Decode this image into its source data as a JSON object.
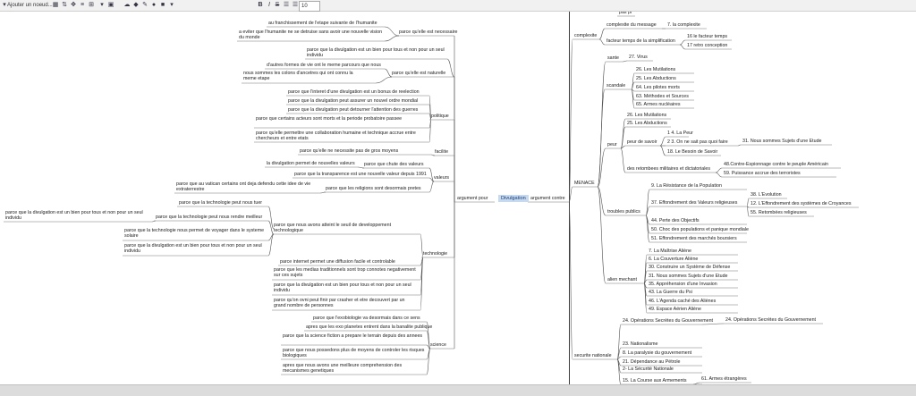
{
  "toolbar": {
    "add_node_label": "Ajouter un noeud...",
    "bold": "B",
    "italic": "I",
    "strike": "S",
    "font_size": "10"
  },
  "map": {
    "root": "Divulgation",
    "left_branch": "argument pour",
    "right_branch": "argument contre",
    "left": [
      {
        "label": "parce qu'elle est necessaire",
        "kids": [
          "au franchissement de l'etape suivante de l'humanite",
          "a eviter que l'humanite ne se detruise sans avoir une nouvelle vision du monde"
        ]
      },
      {
        "label": "parce qu'elle est naturelle",
        "kids": [
          "parce que la divulgation est un bien pour tous et non pour un seul individu",
          "d'autres formes de vie ont le meme parcours que nous",
          "nous sommes les colons d'ancetres qui ont connu  la meme etape"
        ]
      },
      {
        "label": "politique",
        "kids": [
          "parce que l'interet d'une divulgation est un bonus de reelection",
          "parce que la divulgation peut assurer un nouvel ordre mondial",
          "parce que la divulgation peut detourner l'attention des guerres",
          "parce que certains acteurs sont morts et la periode probatoire passee",
          "parce qu'elle permettre une collaboration humaine et technique accrue entre chercheurs et entre etats"
        ]
      },
      {
        "label": "facilite",
        "kids": [
          "parce qu'elle ne necessite pas de gros moyens"
        ]
      },
      {
        "label": "valeurs",
        "kids": [
          "parce que la technologie peut nous tuer"
        ]
      },
      {
        "label": "technologie",
        "kids": []
      },
      {
        "label": "science",
        "kids": [
          "parce que l'exobiologie va desormais dans ce sens",
          "apres que les exo planetes entrent dans la banalite publique",
          "parce que la science fiction a prepare le terrain depuis des annees",
          "parce que nous possedons plus de moyens de controler les risques biologiques",
          "apres que nous avons une meilleure comprehension des mecanismes genetiques"
        ]
      }
    ],
    "valeurs_sub": [
      {
        "label": "parce que chute des valeurs",
        "kids": [
          "la divulgation permet de nouvelles valeurs"
        ]
      },
      "parce que la transparence est une nouvelle valeur depuis 1991",
      {
        "label": "parce que les religions sont desormais pretes",
        "kids": [
          "parce que au vatican certains ont deja defendu cette idee de vie extraterrestre"
        ]
      }
    ],
    "techno_sub": [
      {
        "label": "parce que nous avons atteint le seuil de developpement technologique",
        "kids": [
          "parce que la technologie peut nous rendre meilleur",
          "parce que la technologie nous permet de voyager dans le systeme solaire",
          "parce que la divulgation est un bien pour tous et non pour un seul individu"
        ]
      },
      "parce internet permet une diffusion facile et controlable",
      "parce que les medias traditionnels sont trop connotes negativement sur ces sujets",
      "parce que la divulgation est un bien pour tous et non pour un seul individu",
      "parce qu'on ovni peut finir par crasher et etre decouvert par un grand nombre de personnes"
    ],
    "far_left": "parce que la divulgation est un bien pour tous et non pour un seul individu",
    "right": {
      "top_text": "pas pr",
      "complexite": {
        "label": "complexite",
        "kids": [
          "complexite du message",
          "facteur temps de la simplification"
        ],
        "sub": [
          "7. la complexite",
          "16 le facteur temps",
          "17 retro conception"
        ]
      },
      "menace": "MENACE",
      "sante": {
        "label": "sante",
        "kids": [
          "27. Virus"
        ]
      },
      "scandale": {
        "label": "scandale",
        "kids": [
          "26. Les Mutilations",
          "25. Les Abductions",
          "64. Les pilotes morts",
          "63. Méthodes et Sources",
          "65. Armes nucléaires"
        ]
      },
      "peur": {
        "label": "peur",
        "kids": [
          "26. Les Mutilations",
          "25. Les Abductions"
        ]
      },
      "peur_de_savoir": {
        "label": "peur de savoir",
        "kids": [
          "1 4. La Peur",
          "2 3. On ne sait pas quoi faire",
          "18. Le Besoin de Savoir"
        ],
        "sub": "31. Nous sommes Sujets d'une Etude"
      },
      "dictatoriales": {
        "label": "des retombees militaires et dictatoriales",
        "kids": [
          "48.Contre-Espionnage contre le peuple Américain",
          "59. Puissance accrue des terroristes"
        ]
      },
      "troubles": {
        "label": "troubles publics",
        "kids": [
          "9. La Résistance de la Population",
          "37. Effondrement des Valeurs religieuses",
          "44. Perte des Objectifs",
          "50. Choc des populations et panique mondiale",
          "51. Effondrement des marchés boursiers"
        ],
        "sub": [
          "38. L'Evolution",
          "12. L'Effondrement des systèmes de Croyances",
          "55. Retombées religieuses"
        ]
      },
      "alien": {
        "label": "alien mechant",
        "kids": [
          "7. La Maîtrise Aliène",
          "6. La Couverture Aliène",
          "30. Construire un Système de Défense",
          "31. Nous sommes Sujets d'une Etude",
          "35. Appréhension d'une Invasion",
          "43. La Guerre du Psi",
          "46. L'Agenda caché des Aliènes",
          "49. Espace Aérien Aliène"
        ]
      },
      "securite": {
        "label": "securite nationale",
        "kids": [
          "24. Opérations Secrètes du Gouvernement",
          "23. Nationalisme",
          "8. La paralysie du gouvernement",
          "21. Dépendance au Pétrole",
          "2- La Sécurité Nationale",
          "15. La Course aux Armements"
        ],
        "sub": [
          "24. Opérations Secrètes du Gouvernement",
          "61. Armes étrangères"
        ]
      }
    }
  }
}
